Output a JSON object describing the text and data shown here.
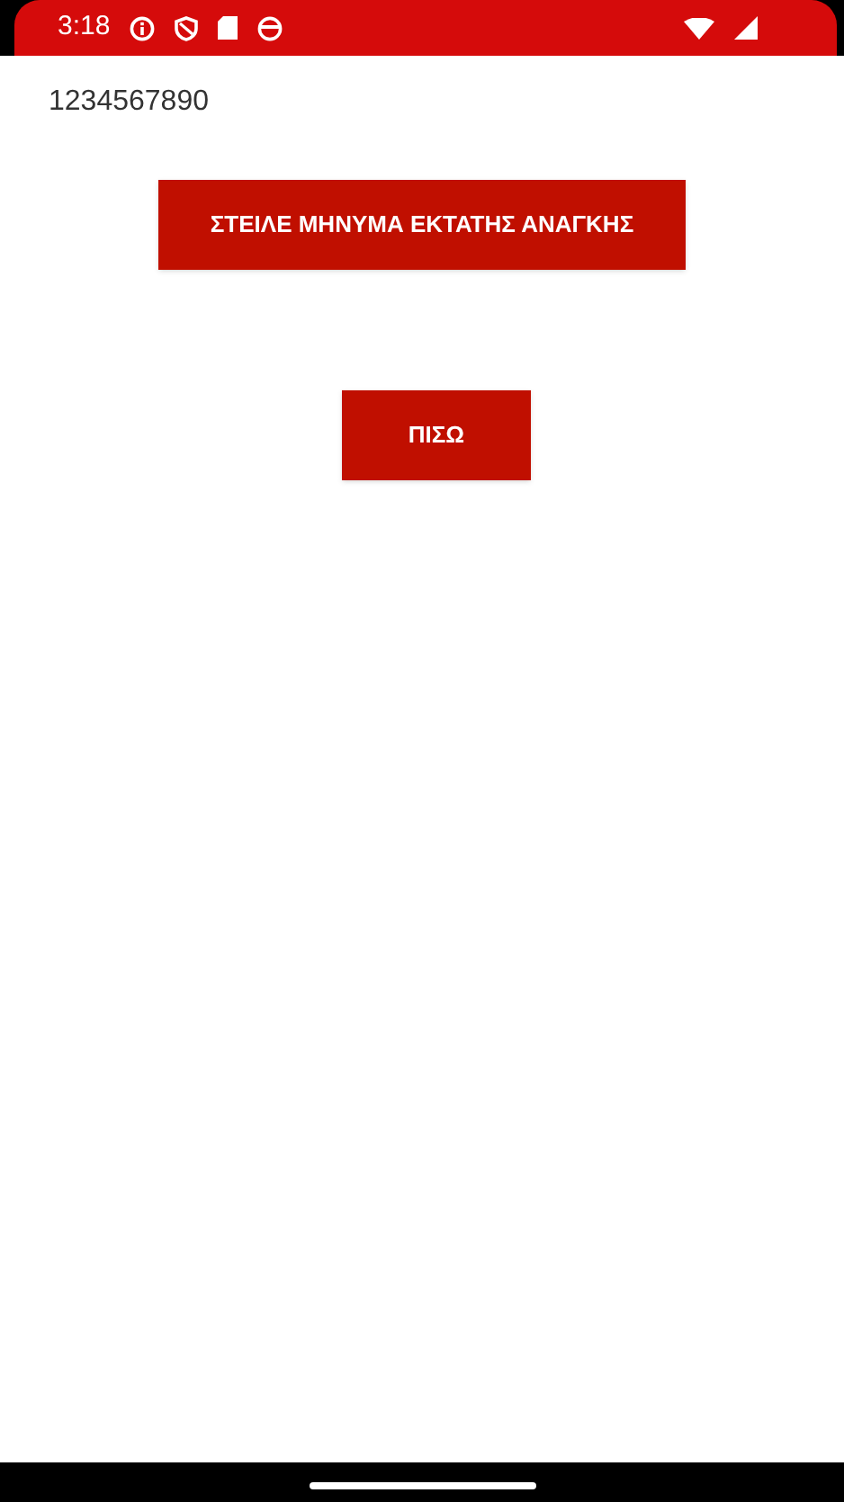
{
  "status_bar": {
    "time": "3:18"
  },
  "phone_number": "1234567890",
  "buttons": [
    {
      "label": "ΣΤΕΙΛΕ ΜΗΝΥΜΑ ΕΚΤΑΤΗΣ ΑΝΑΓΚΗΣ",
      "kind": "wide"
    },
    {
      "label": "ΠΙΣΩ",
      "kind": "narrow"
    }
  ]
}
